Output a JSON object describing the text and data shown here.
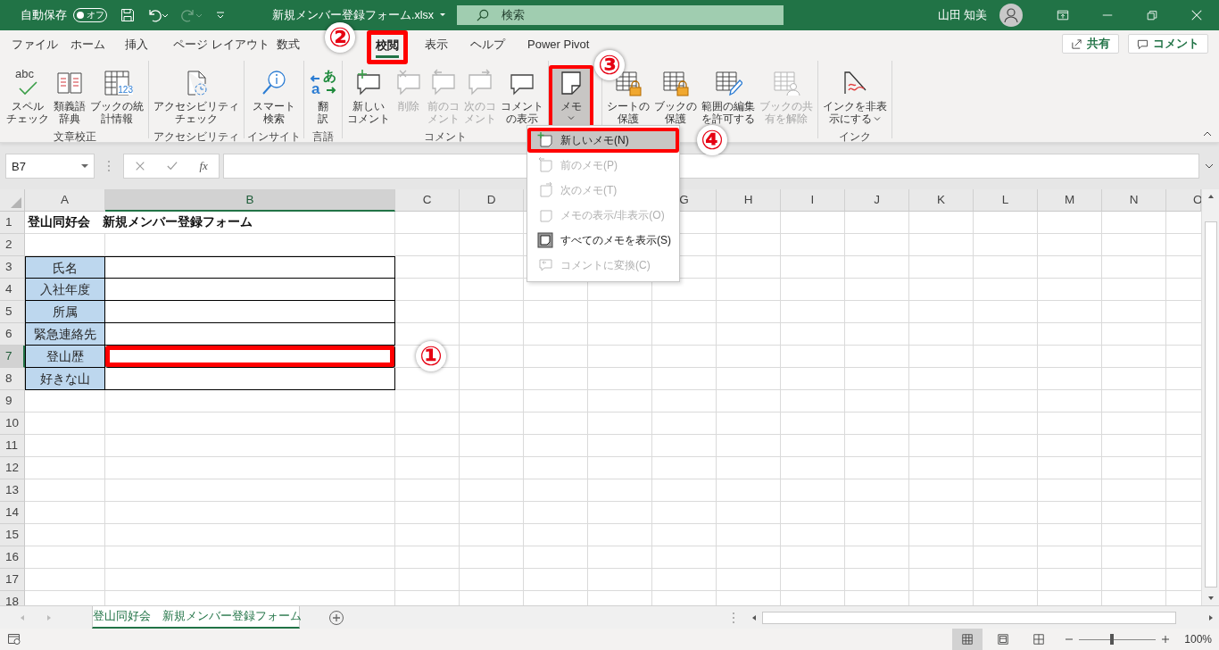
{
  "title_bar": {
    "autosave_label": "自動保存",
    "autosave": {
      "on": false,
      "label": "オフ"
    },
    "redo_disabled": true,
    "filename": "新規メンバー登録フォーム.xlsx",
    "search_placeholder": "検索",
    "user_name": "山田 知美"
  },
  "menu_tabs": [
    {
      "label": "ファイル",
      "selected": false,
      "highlighted": false
    },
    {
      "label": "ホーム",
      "selected": false,
      "highlighted": false
    },
    {
      "label": "挿入",
      "selected": false,
      "highlighted": false
    },
    {
      "label": "ページ レイアウト",
      "selected": false,
      "highlighted": false
    },
    {
      "label": "数式",
      "selected": false,
      "highlighted": false
    },
    {
      "label": "校閲",
      "selected": true,
      "highlighted": true,
      "callout": "②"
    },
    {
      "label": "表示",
      "selected": false,
      "highlighted": false
    },
    {
      "label": "ヘルプ",
      "selected": false,
      "highlighted": false
    },
    {
      "label": "Power Pivot",
      "selected": false,
      "highlighted": false
    }
  ],
  "share_button": "共有",
  "comment_button": "コメント",
  "ribbon_groups": [
    {
      "label": "文章校正",
      "buttons": [
        {
          "kind": "spell",
          "glyphs": [
            "abc"
          ],
          "lines": [
            "スペル",
            "チェック"
          ],
          "disabled": false,
          "pressed": false,
          "highlighted": false
        },
        {
          "kind": "thesaurus",
          "lines": [
            "類義語",
            "辞典"
          ],
          "disabled": false,
          "pressed": false,
          "highlighted": false
        },
        {
          "kind": "stats",
          "glyphs": [
            "123"
          ],
          "lines": [
            "ブックの統",
            "計情報"
          ],
          "disabled": false,
          "pressed": false,
          "highlighted": false
        }
      ]
    },
    {
      "label": "アクセシビリティ",
      "buttons": [
        {
          "kind": "accessibility",
          "lines": [
            "アクセシビリティ",
            "チェック"
          ],
          "disabled": false,
          "pressed": false,
          "highlighted": false
        }
      ]
    },
    {
      "label": "インサイト",
      "buttons": [
        {
          "kind": "smart",
          "lines": [
            "スマート",
            "検索"
          ],
          "disabled": false,
          "pressed": false,
          "highlighted": false
        }
      ]
    },
    {
      "label": "言語",
      "buttons": [
        {
          "kind": "translate",
          "glyphs": [
            "あ",
            "a"
          ],
          "lines": [
            "翻",
            "訳"
          ],
          "disabled": false,
          "pressed": false,
          "highlighted": false
        }
      ]
    },
    {
      "label": "コメント",
      "buttons": [
        {
          "kind": "new-comment",
          "lines": [
            "新しい",
            "コメント"
          ],
          "disabled": false,
          "pressed": false,
          "highlighted": false
        },
        {
          "kind": "delete-comment",
          "lines": [
            "削除"
          ],
          "disabled": true,
          "pressed": false,
          "highlighted": false
        },
        {
          "kind": "prev-comment",
          "lines": [
            "前のコ",
            "メント"
          ],
          "disabled": true,
          "pressed": false,
          "highlighted": false
        },
        {
          "kind": "next-comment",
          "lines": [
            "次のコ",
            "メント"
          ],
          "disabled": true,
          "pressed": false,
          "highlighted": false
        },
        {
          "kind": "show-comments",
          "lines": [
            "コメント",
            "の表示"
          ],
          "disabled": false,
          "pressed": false,
          "highlighted": false
        }
      ]
    },
    {
      "buttons": [
        {
          "kind": "memo",
          "lines": [
            "メモ"
          ],
          "dropdown": true,
          "disabled": false,
          "pressed": true,
          "highlighted": true,
          "callout": "③"
        }
      ]
    },
    {
      "buttons": [
        {
          "kind": "protect-sheet",
          "lines": [
            "シートの",
            "保護"
          ],
          "disabled": false,
          "pressed": false,
          "highlighted": false
        },
        {
          "kind": "protect-book",
          "lines": [
            "ブックの",
            "保護"
          ],
          "disabled": false,
          "pressed": false,
          "highlighted": false
        },
        {
          "kind": "allow-edit",
          "lines": [
            "範囲の編集",
            "を許可する"
          ],
          "disabled": false,
          "pressed": false,
          "highlighted": false
        },
        {
          "kind": "unshare",
          "lines": [
            "ブックの共",
            "有を解除"
          ],
          "disabled": true,
          "pressed": false,
          "highlighted": false
        }
      ]
    },
    {
      "label": "インク",
      "buttons": [
        {
          "kind": "ink",
          "lines": [
            "インクを非表",
            "示にする"
          ],
          "dropdown": true,
          "disabled": false,
          "pressed": false,
          "highlighted": false
        }
      ]
    }
  ],
  "memo_menu": [
    {
      "kind": "new",
      "label": "新しいメモ(N)",
      "disabled": false,
      "highlighted": true,
      "callout": "④"
    },
    {
      "kind": "prev",
      "label": "前のメモ(P)",
      "disabled": true,
      "highlighted": false
    },
    {
      "kind": "next",
      "label": "次のメモ(T)",
      "disabled": true,
      "highlighted": false
    },
    {
      "kind": "toggle",
      "label": "メモの表示/非表示(O)",
      "disabled": true,
      "highlighted": false
    },
    {
      "kind": "show-all",
      "label": "すべてのメモを表示(S)",
      "disabled": false,
      "highlighted": false
    },
    {
      "kind": "convert",
      "label": "コメントに変換(C)",
      "disabled": true,
      "highlighted": false
    }
  ],
  "name_box": "B7",
  "function_button": "fx",
  "columns": [
    {
      "label": "A",
      "selected": false
    },
    {
      "label": "B",
      "selected": true
    },
    {
      "label": "C",
      "selected": false
    },
    {
      "label": "D",
      "selected": false
    },
    {},
    {},
    {
      "label": "G",
      "selected": false
    },
    {
      "label": "H",
      "selected": false
    },
    {
      "label": "I",
      "selected": false
    },
    {
      "label": "J",
      "selected": false
    },
    {
      "label": "K",
      "selected": false
    },
    {
      "label": "L",
      "selected": false
    },
    {
      "label": "M",
      "selected": false
    },
    {
      "label": "N",
      "selected": false
    },
    {
      "label": "O",
      "selected": false
    }
  ],
  "rows": [
    {
      "number": "1",
      "selected": false,
      "title": "登山同好会　新規メンバー登録フォーム"
    },
    {
      "number": "2",
      "selected": false
    },
    {
      "number": "3",
      "selected": false,
      "label": "氏名",
      "highlighted": false
    },
    {
      "number": "4",
      "selected": false,
      "label": "入社年度",
      "highlighted": false
    },
    {
      "number": "5",
      "selected": false,
      "label": "所属",
      "highlighted": false
    },
    {
      "number": "6",
      "selected": false,
      "label": "緊急連絡先",
      "highlighted": false
    },
    {
      "number": "7",
      "selected": true,
      "label": "登山歴",
      "highlighted": true,
      "callout": "①"
    },
    {
      "number": "8",
      "selected": false,
      "label": "好きな山",
      "highlighted": false
    },
    {
      "number": "9",
      "selected": false
    },
    {
      "number": "10",
      "selected": false
    },
    {
      "number": "11",
      "selected": false
    },
    {
      "number": "12",
      "selected": false
    },
    {
      "number": "13",
      "selected": false
    },
    {
      "number": "14",
      "selected": false
    },
    {
      "number": "15",
      "selected": false
    },
    {
      "number": "16",
      "selected": false
    },
    {
      "number": "17",
      "selected": false
    },
    {
      "number": "18",
      "selected": false
    }
  ],
  "sheet_tabs": [
    {
      "label": "登山同好会　新規メンバー登録フォーム",
      "selected": true
    }
  ],
  "views": [
    {
      "kind": "normal",
      "selected": true
    },
    {
      "kind": "page-layout",
      "selected": false
    },
    {
      "kind": "page-break",
      "selected": false
    }
  ],
  "zoom": {
    "level": 0.43,
    "reading": "100%"
  }
}
